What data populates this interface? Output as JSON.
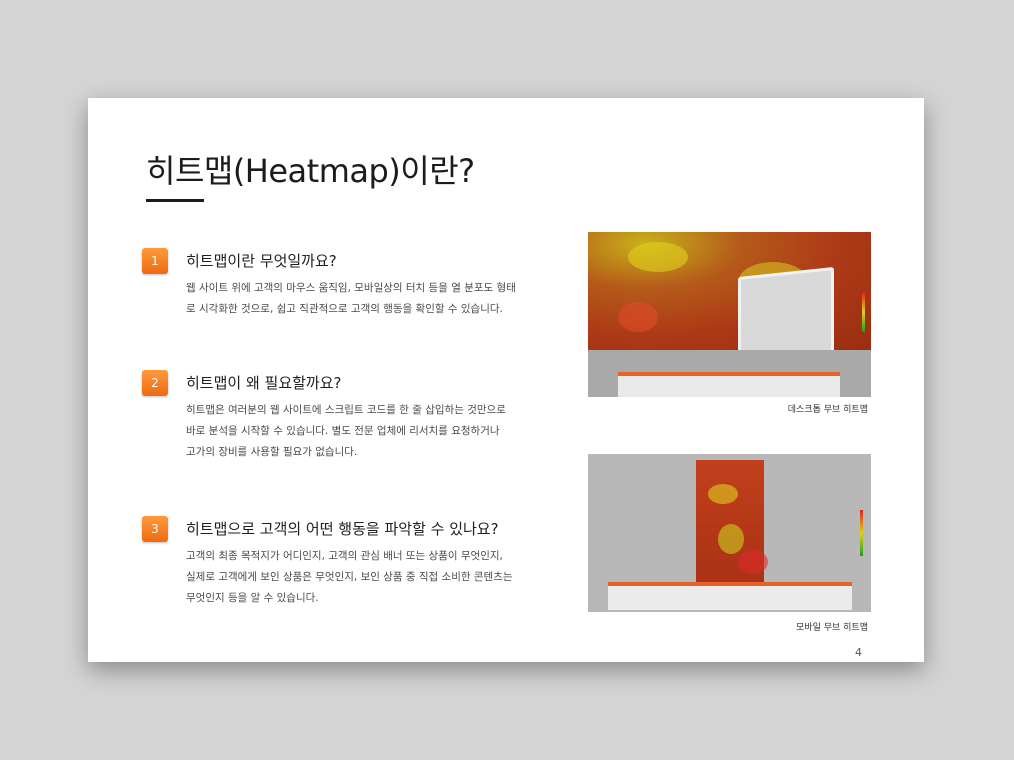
{
  "slide": {
    "title": "히트맵(Heatmap)이란?",
    "page_number": "4"
  },
  "items": [
    {
      "number": "1",
      "title": "히트맵이란 무엇일까요?",
      "body": [
        "웹 사이트 위에 고객의 마우스 움직임, 모바일상의 터치 등을 열 분포도 형태",
        "로 시각화한 것으로, 쉽고 직관적으로 고객의 행동을 확인할 수 있습니다."
      ]
    },
    {
      "number": "2",
      "title": "히트맵이 왜 필요할까요?",
      "body": [
        "히트맵은 여러분의 웹 사이트에 스크립트 코드를 한 줄 삽입하는 것만으로",
        "바로 분석을 시작할 수 있습니다. 별도 전문 업체에 리서치를 요청하거나",
        "고가의 장비를 사용할 필요가 없습니다."
      ]
    },
    {
      "number": "3",
      "title": "히트맵으로 고객의 어떤 행동을 파악할 수 있나요?",
      "body": [
        "고객의 최종 목적지가 어디인지, 고객의 관심 배너 또는 상품이 무엇인지,",
        "실제로 고객에게 보인 상품은 무엇인지, 보인 상품 중 직접 소비한 콘텐츠는",
        "무엇인지 등을 알 수 있습니다."
      ]
    }
  ],
  "images": {
    "desktop_caption": "데스크톱 무브 히트맵",
    "mobile_caption": "모바일 무브 히트맵"
  },
  "colors": {
    "badge": "#f07a1e",
    "heat_red": "#ad3a16",
    "accent_orange": "#e8612a"
  }
}
